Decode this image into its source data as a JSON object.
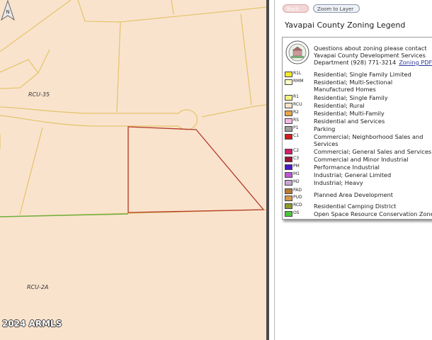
{
  "map": {
    "zone_labels": [
      "RCU-35",
      "RCU-2A"
    ],
    "copyright": "2024 ARMLS",
    "north_label": "N",
    "colors": {
      "background": "#fae3cd",
      "parcel_lines": "#e3c66f",
      "selected_parcel": "#b13a28",
      "zone_boundary": "#70b040"
    }
  },
  "toolbar": {
    "back_label": "Back",
    "zoom_label": "Zoom to Layer"
  },
  "legend": {
    "title": "Yavapai County Zoning Legend",
    "contact": "Questions about zoning please contact Yavapai County Development Services Department (928) 771-3214",
    "zoning_pdf_label": "Zoning PDF",
    "seal_icon": "county-seal-icon",
    "items": [
      {
        "code": "R1L",
        "description": "Residential; Single Family Limited",
        "color": "#f5e82a"
      },
      {
        "code": "RMM",
        "description": "Residential; Multi-Sectional Manufactured Homes",
        "color": "#fafac6"
      },
      {
        "code": "R1",
        "description": "Residential; Single Family",
        "color": "#f3f37c"
      },
      {
        "code": "RCU",
        "description": "Residential; Rural",
        "color": "#fbe2cc"
      },
      {
        "code": "R2",
        "description": "Residential; Multi-Family",
        "color": "#e8a548"
      },
      {
        "code": "RS",
        "description": "Residential and Services",
        "color": "#f4b9e3"
      },
      {
        "code": "P1",
        "description": "Parking",
        "color": "#a0a0a0"
      },
      {
        "code": "C1",
        "description": "Commercial; Neighborhood Sales and Services",
        "color": "#d81b1b"
      },
      {
        "code": "C2",
        "description": "Commercial; General Sales and Services",
        "color": "#d41d6a"
      },
      {
        "code": "C3",
        "description": "Commercial and Minor Industrial",
        "color": "#a0123a"
      },
      {
        "code": "PM",
        "description": "Performance Industrial",
        "color": "#4a18c9"
      },
      {
        "code": "M1",
        "description": "Industrial; General Limited",
        "color": "#c056d6"
      },
      {
        "code": "M2",
        "description": "Industrial; Heavy",
        "color": "#c8a6cf"
      },
      {
        "code": "PAD",
        "description": "Planned Area Development",
        "color": "#b77b36"
      },
      {
        "code": "PUD",
        "description": "",
        "color": "#d49a4c"
      },
      {
        "code": "RCD",
        "description": "Residential Camping District",
        "color": "#8e9a2c"
      },
      {
        "code": "OS",
        "description": "Open Space Resource Conservation Zone",
        "color": "#4bc63a"
      }
    ]
  }
}
